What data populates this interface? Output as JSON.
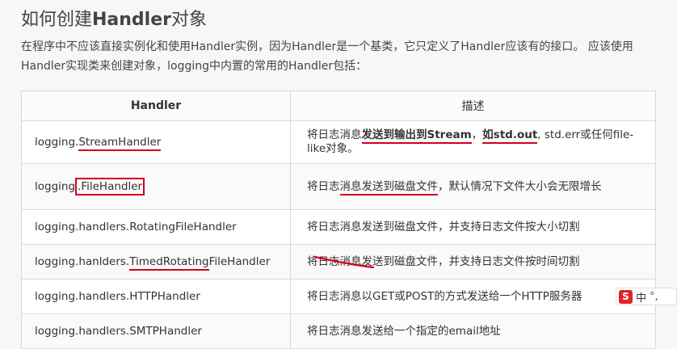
{
  "title": {
    "prefix": "如何创建",
    "bold": "Handler",
    "suffix": "对象"
  },
  "intro": "在程序中不应该直接实例化和使用Handler实例，因为Handler是一个基类，它只定义了Handler应该有的接口。 应该使用Handler实现类来创建对象，logging中内置的常用的Handler包括：",
  "table": {
    "headers": [
      "Handler",
      "描述"
    ],
    "rows": [
      {
        "pre": "logging.",
        "mark": "StreamHandler",
        "post": "",
        "desc": {
          "a": "将日志消息",
          "u": "发送到输出到Stream",
          "b": "，",
          "u2": "如std.out",
          "c": ", std.err或任何file-like对象。"
        }
      },
      {
        "pre": "logging",
        "mark": ".FileHandler",
        "post": "",
        "desc": {
          "a": "将日志",
          "u": "消息发送到磁盘文件",
          "b": "，默认情况下文件大小会无限增长",
          "u2": "",
          "c": ""
        }
      },
      {
        "pre": "",
        "mark": "",
        "post": "logging.handlers.RotatingFileHandler",
        "desc": {
          "a": "将日志消息发送到磁盘文件，并支持日志文件按大小切割",
          "u": "",
          "b": "",
          "u2": "",
          "c": ""
        }
      },
      {
        "pre": "logging.hanlders.",
        "mark": "TimedRotating",
        "post": "FileHandler",
        "desc": {
          "a": "将日志消息发送到磁盘文件，并支持日志文件按时间切割",
          "u": "",
          "b": "",
          "u2": "",
          "c": ""
        }
      },
      {
        "pre": "",
        "mark": "",
        "post": "logging.handlers.HTTPHandler",
        "desc": {
          "a": "将日志消息以GET或POST的方式发送给一个HTTP服务器",
          "u": "",
          "b": "",
          "u2": "",
          "c": ""
        }
      },
      {
        "pre": "",
        "mark": "",
        "post": "logging.handlers.SMTPHandler",
        "desc": {
          "a": "将日志消息发送给一个指定的email地址",
          "u": "",
          "b": "",
          "u2": "",
          "c": ""
        }
      }
    ]
  },
  "ime": {
    "logo": "S",
    "lang": "中",
    "punct": "°,"
  },
  "colors": {
    "annotation": "#d0021b",
    "ime_brand": "#e0222a"
  }
}
